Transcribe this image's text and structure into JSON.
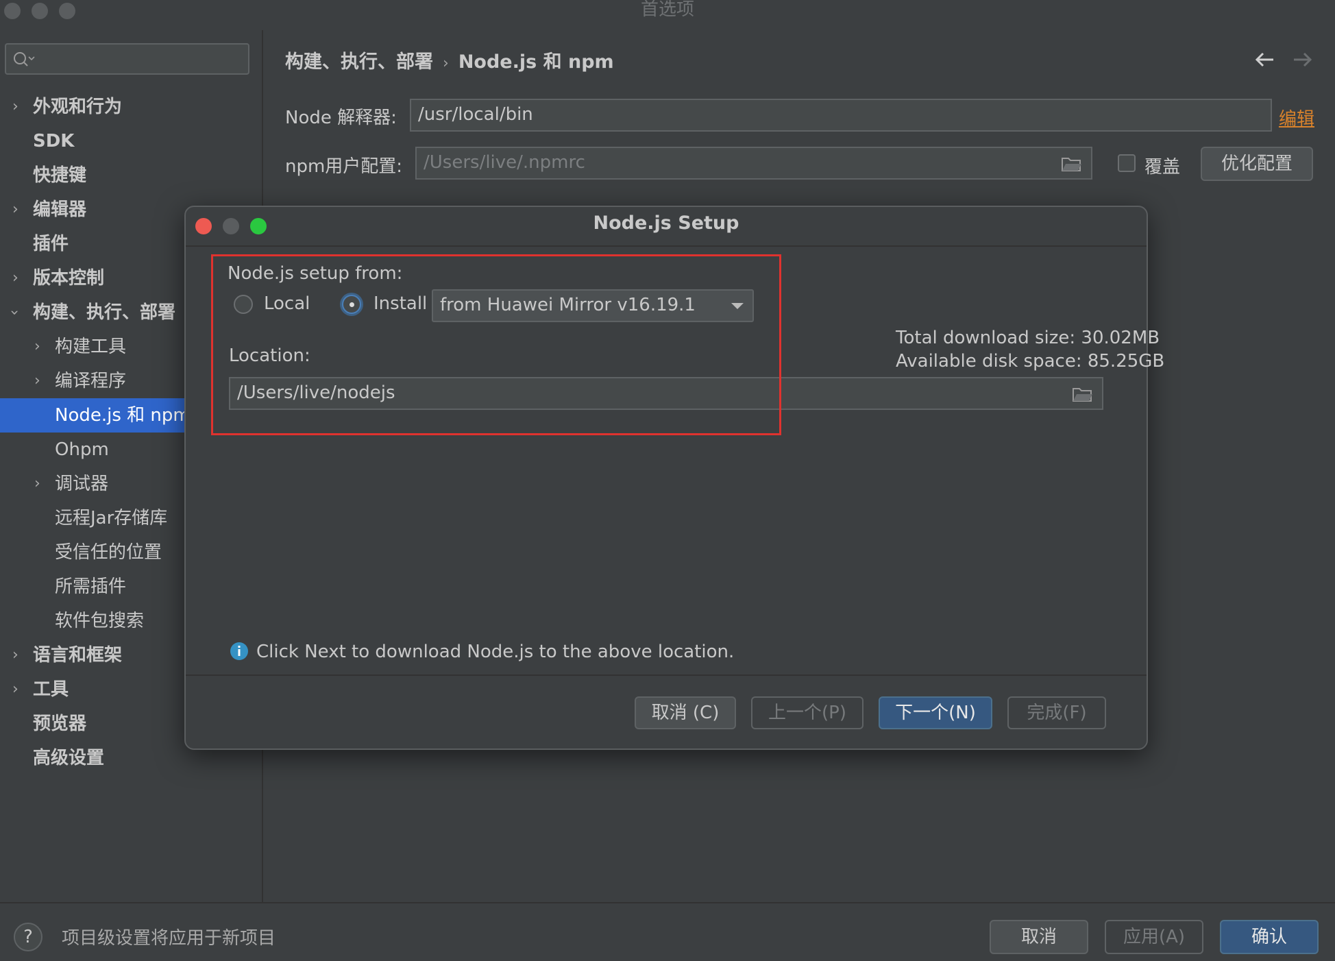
{
  "window": {
    "title": "首选项"
  },
  "sidebar": {
    "items": [
      {
        "label": "外观和行为"
      },
      {
        "label": "SDK"
      },
      {
        "label": "快捷键"
      },
      {
        "label": "编辑器"
      },
      {
        "label": "插件"
      },
      {
        "label": "版本控制"
      },
      {
        "label": "构建、执行、部署"
      },
      {
        "label": "构建工具"
      },
      {
        "label": "编译程序"
      },
      {
        "label": "Node.js 和 npm"
      },
      {
        "label": "Ohpm"
      },
      {
        "label": "调试器"
      },
      {
        "label": "远程Jar存储库"
      },
      {
        "label": "受信任的位置"
      },
      {
        "label": "所需插件"
      },
      {
        "label": "软件包搜索"
      },
      {
        "label": "语言和框架"
      },
      {
        "label": "工具"
      },
      {
        "label": "预览器"
      },
      {
        "label": "高级设置"
      }
    ]
  },
  "breadcrumb": {
    "parent": "构建、执行、部署",
    "separator": "›",
    "current": "Node.js 和 npm"
  },
  "form": {
    "node_label": "Node 解释器:",
    "node_value": "/usr/local/bin",
    "edit_link": "编辑",
    "npm_label": "npm用户配置:",
    "npm_placeholder": "/Users/live/.npmrc",
    "override_label": "覆盖",
    "optimize_button": "优化配置"
  },
  "dialog": {
    "title": "Node.js Setup",
    "setup_from_label": "Node.js setup from:",
    "radio_local": "Local",
    "radio_install": "Install",
    "selected_source": "from Huawei Mirror v16.19.1",
    "location_label": "Location:",
    "location_value": "/Users/live/nodejs",
    "total_download": "Total download size: 30.02MB",
    "available_space": "Available disk space: 85.25GB",
    "info_text": "Click Next to download Node.js to the above location.",
    "buttons": {
      "cancel": "取消 (C)",
      "prev": "上一个(P)",
      "next": "下一个(N)",
      "finish": "完成(F)"
    }
  },
  "footer": {
    "hint": "项目级设置将应用于新项目",
    "cancel": "取消",
    "apply": "应用(A)",
    "ok": "确认"
  },
  "colors": {
    "accent": "#2f65ca",
    "link": "#d9822b",
    "highlight_border": "#e0322e",
    "info": "#3592c4"
  }
}
